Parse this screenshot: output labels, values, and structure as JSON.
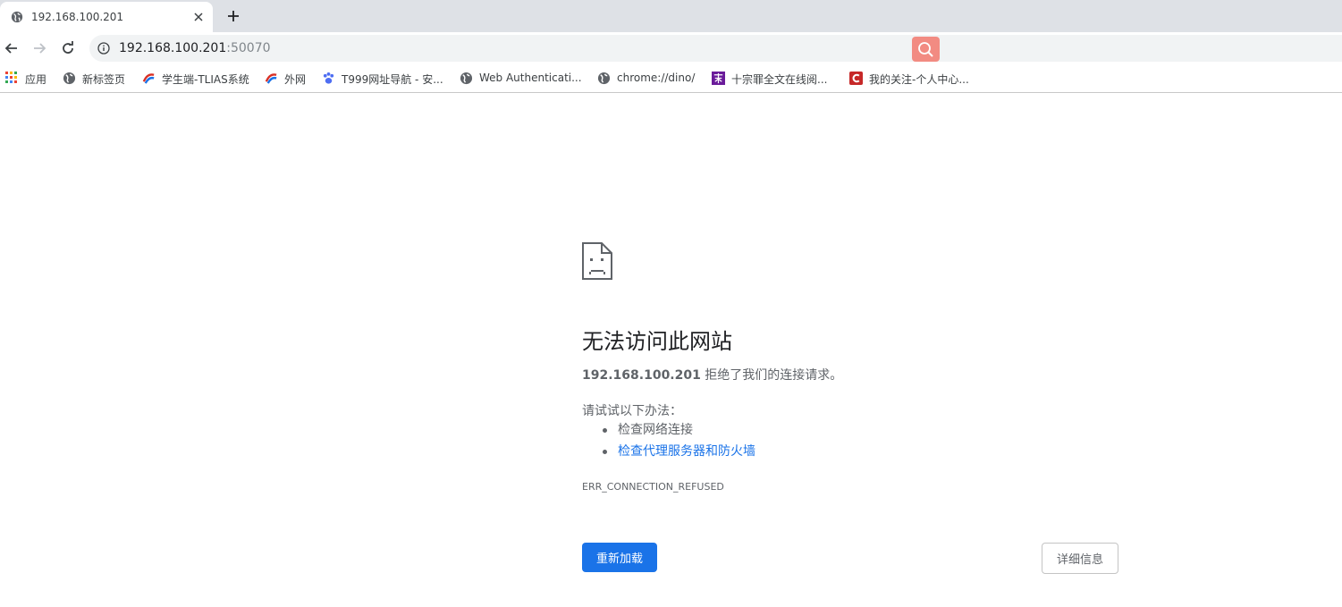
{
  "tab": {
    "title": "192.168.100.201",
    "favicon": "globe-icon",
    "close_icon": "close-icon"
  },
  "new_tab_icon": "plus-icon",
  "toolbar": {
    "back_icon": "back-arrow-icon",
    "forward_icon": "forward-arrow-icon",
    "reload_icon": "reload-icon",
    "site_info_icon": "info-icon",
    "url_host": "192.168.100.201",
    "url_port": ":50070",
    "search_extension_icon": "search-icon",
    "search_extension_color": "#f28b82"
  },
  "bookmarks": [
    {
      "label": "应用",
      "icon": "apps-grid-icon"
    },
    {
      "label": "新标签页",
      "icon": "globe-icon"
    },
    {
      "label": "学生端-TLIAS系统",
      "icon": "tlias-logo-icon"
    },
    {
      "label": "外网",
      "icon": "tlias-logo-icon"
    },
    {
      "label": "T999网址导航 - 安...",
      "icon": "paw-icon"
    },
    {
      "label": "Web Authenticati...",
      "icon": "globe-icon"
    },
    {
      "label": "chrome://dino/",
      "icon": "globe-icon"
    },
    {
      "label": "十宗罪全文在线阅...",
      "icon": "purple-book-icon"
    },
    {
      "label": "我的关注-个人中心...",
      "icon": "red-c-icon"
    }
  ],
  "error": {
    "icon": "sad-page-icon",
    "title": "无法访问此网站",
    "host": "192.168.100.201",
    "desc_suffix": " 拒绝了我们的连接请求。",
    "try_heading": "请试试以下办法：",
    "suggestions": [
      "检查网络连接",
      "检查代理服务器和防火墙"
    ],
    "code": "ERR_CONNECTION_REFUSED",
    "reload_label": "重新加载",
    "details_label": "详细信息"
  },
  "colors": {
    "accent": "#1a73e8",
    "tabstrip": "#dee1e6",
    "omnibox": "#f1f3f4"
  }
}
